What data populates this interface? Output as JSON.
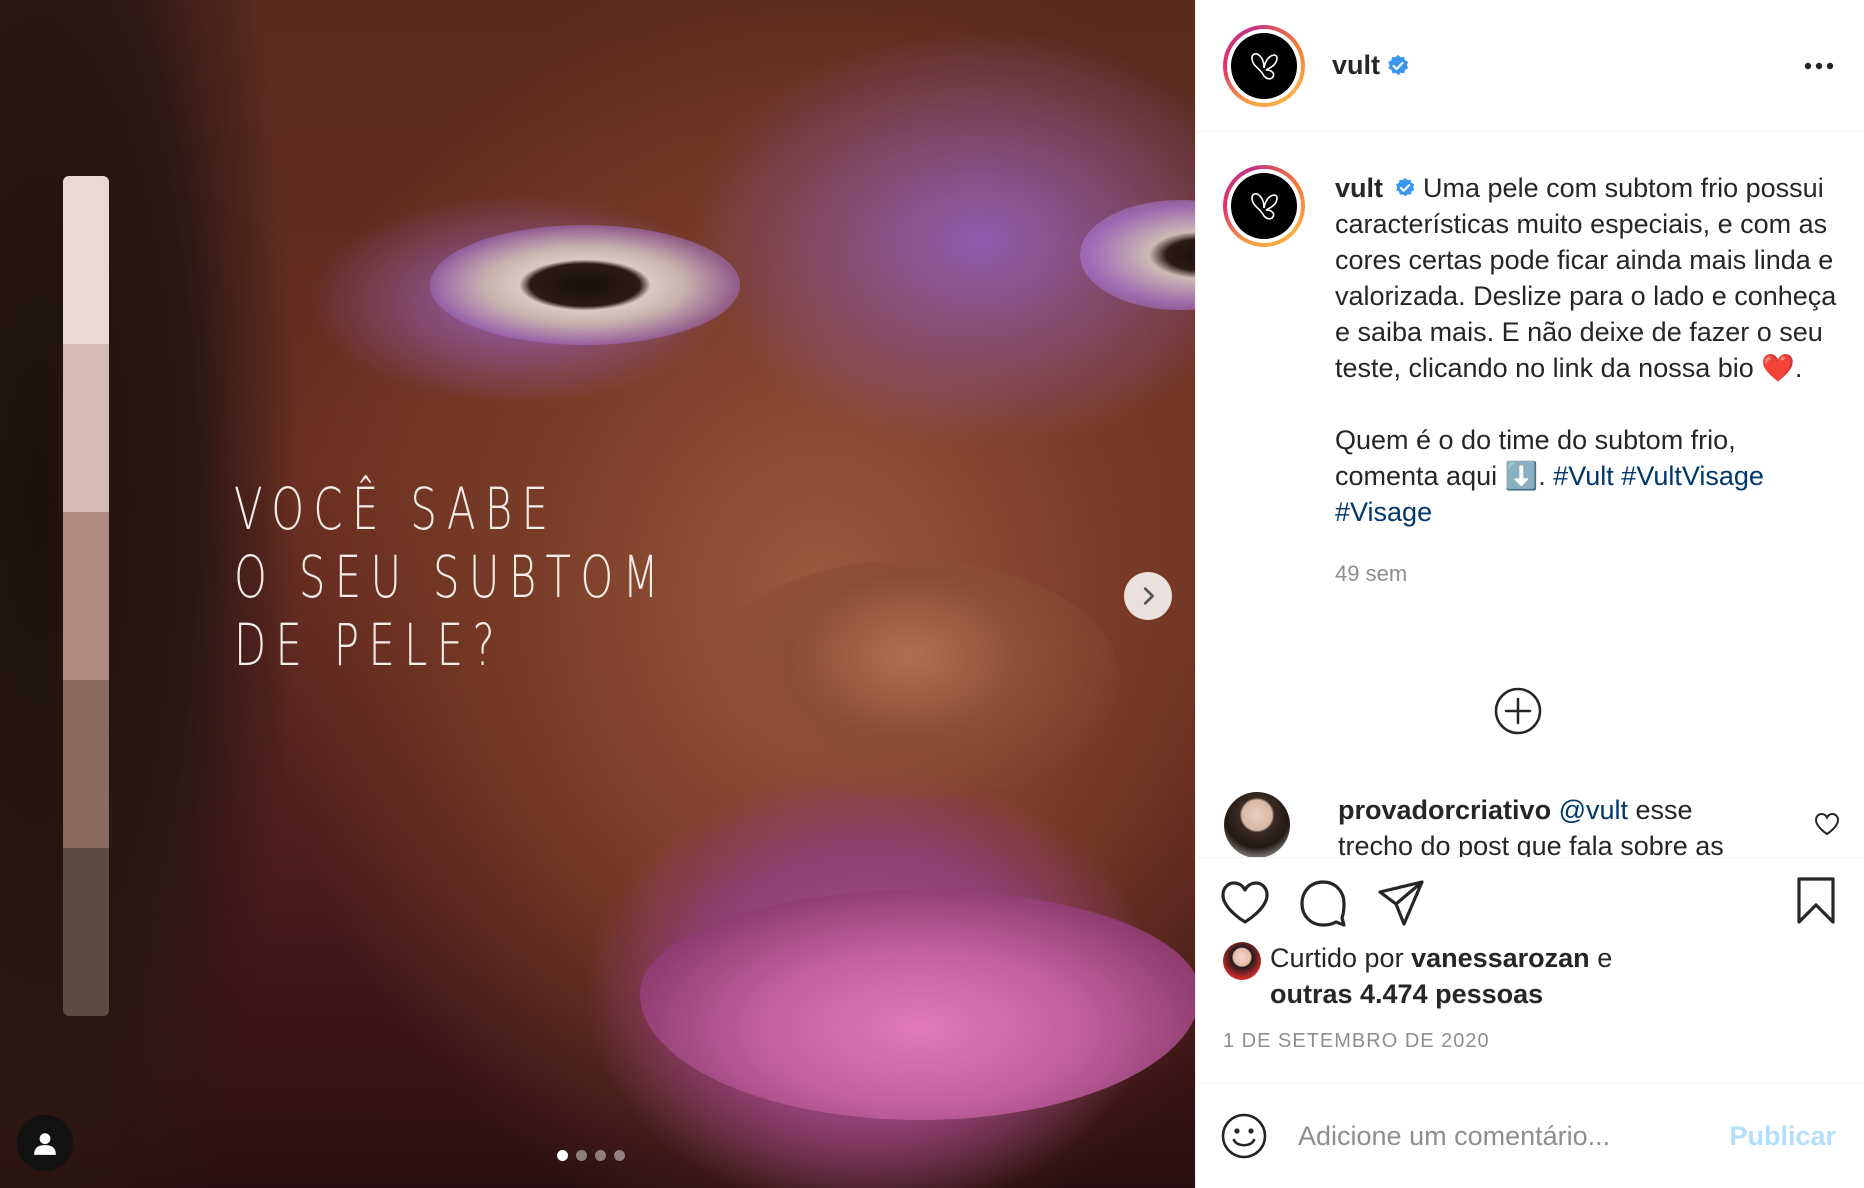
{
  "media": {
    "headline": [
      "VOCÊ SABE",
      "O SEU SUBTOM",
      "DE PELE?"
    ],
    "swatch_colors": [
      "#ecd8d2",
      "#d6bab2",
      "#b08c80",
      "#8a6a5d",
      "#5f4a40"
    ],
    "carousel_dots": 4,
    "active_dot": 0
  },
  "header": {
    "username": "vult",
    "verified": true
  },
  "caption": {
    "username": "vult",
    "text_1": " Uma pele com subtom frio possui características muito especiais, e com as cores certas pode ficar ainda mais linda e valorizada. Deslize para o lado e conheça e saiba mais. E não deixe de fazer o seu teste, clicando no link da nossa bio ❤️.",
    "text_2": "Quem é o do time do subtom frio, comenta aqui ⬇️. ",
    "hashtags": [
      "#Vult",
      "#VultVisage",
      "#Visage"
    ],
    "time_ago": "49 sem"
  },
  "reply": {
    "username": "provadorcriativo",
    "mention": "@vult",
    "text": " esse trecho do post que fala sobre as"
  },
  "likes": {
    "prefix": "Curtido por ",
    "user": "vanessarozan",
    "connector": " e",
    "others": "outras 4.474 pessoas"
  },
  "date": "1 DE SETEMBRO DE 2020",
  "add_comment": {
    "placeholder": "Adicione um comentário...",
    "publish_label": "Publicar"
  },
  "colors": {
    "link": "#00376b",
    "verified": "#3897f0",
    "publish_disabled": "#b2dffc"
  }
}
